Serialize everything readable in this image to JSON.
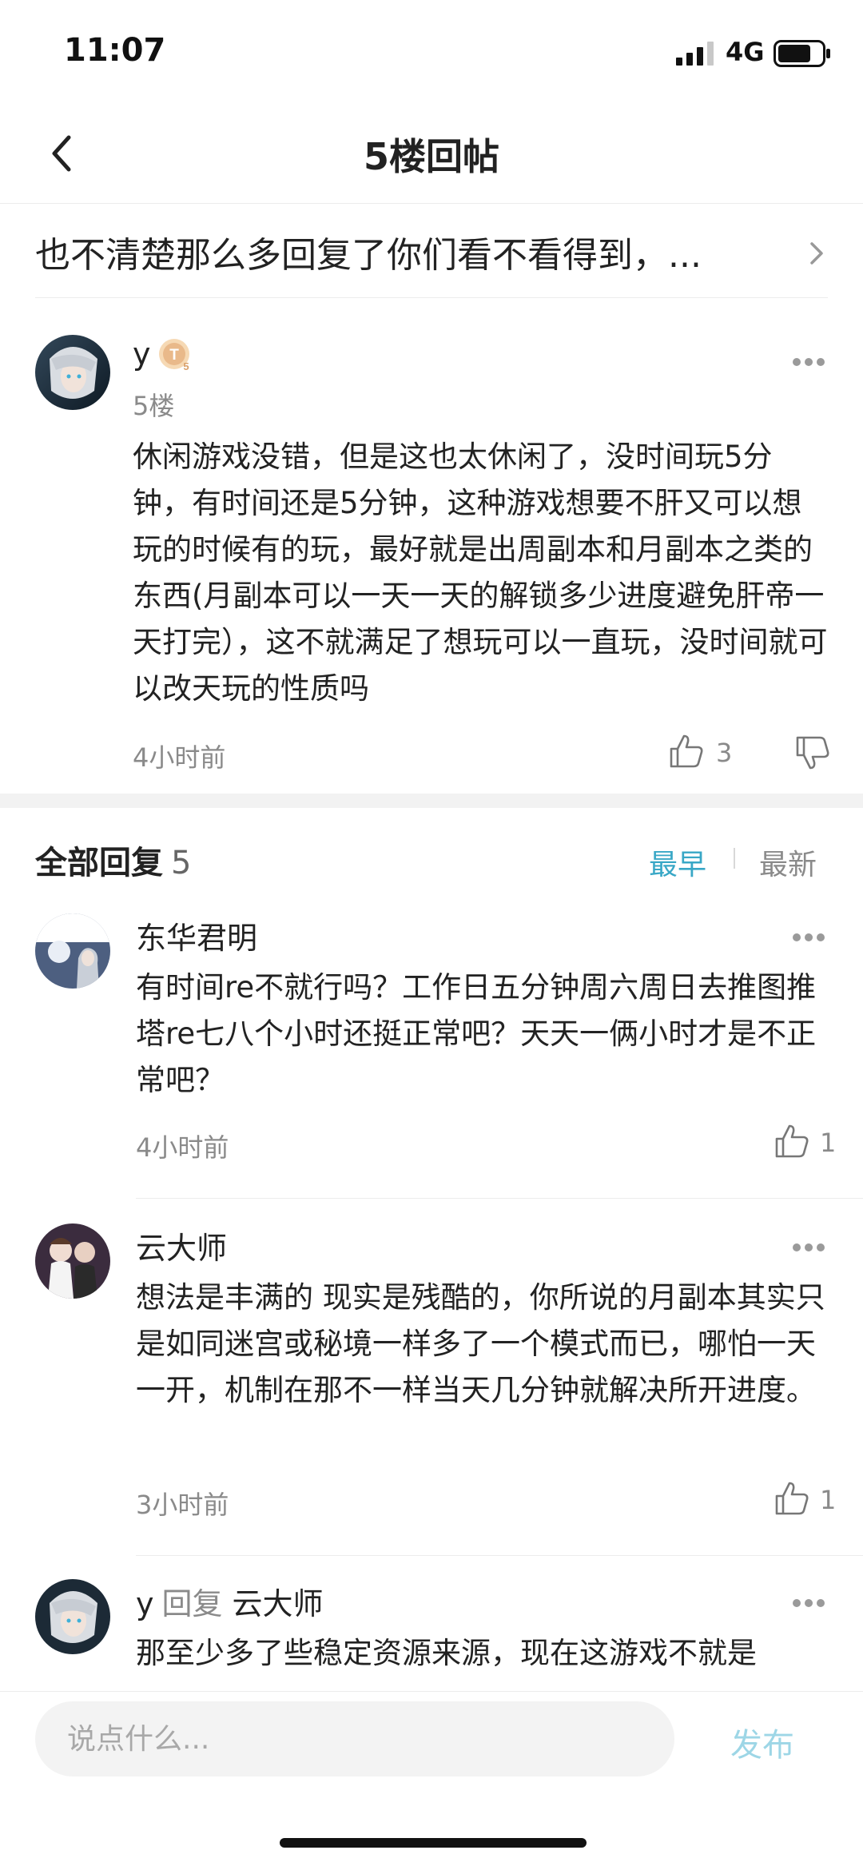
{
  "status_bar": {
    "time": "11:07",
    "network": "4G"
  },
  "nav": {
    "title": "5楼回帖"
  },
  "post": {
    "title": "也不清楚那么多回复了你们看不看得到，..."
  },
  "floor": {
    "username": "y",
    "level_badge": "T5",
    "floor_label": "5楼",
    "content": "休闲游戏没错，但是这也太休闲了，没时间玩5分钟，有时间还是5分钟，这种游戏想要不肝又可以想玩的时候有的玩，最好就是出周副本和月副本之类的东西(月副本可以一天一天的解锁多少进度避免肝帝一天打完），这不就满足了想玩可以一直玩，没时间就可以改天玩的性质吗",
    "time": "4小时前",
    "likes": "3"
  },
  "replies_header": {
    "title": "全部回复",
    "count": "5",
    "sort_earliest": "最早",
    "sort_newest": "最新"
  },
  "replies": [
    {
      "name": "东华君明",
      "content": "有时间re不就行吗？工作日五分钟周六周日去推图推塔re七八个小时还挺正常吧？天天一俩小时才是不正常吧？",
      "time": "4小时前",
      "likes": "1"
    },
    {
      "name": "云大师",
      "content": "想法是丰满的 现实是残酷的，你所说的月副本其实只是如同迷宫或秘境一样多了一个模式而已，哪怕一天一开，机制在那不一样当天几分钟就解决所开进度。",
      "time": "3小时前",
      "likes": "1"
    },
    {
      "name": "y",
      "reply_word": "回复",
      "reply_to": "云大师",
      "content": "那至少多了些稳定资源来源，现在这游戏不就是"
    }
  ],
  "input": {
    "placeholder": "说点什么...",
    "publish_label": "发布"
  },
  "colors": {
    "accent": "#38a7c6",
    "publish_disabled": "#9dd6e6",
    "secondary_text": "#8a8a8a"
  }
}
